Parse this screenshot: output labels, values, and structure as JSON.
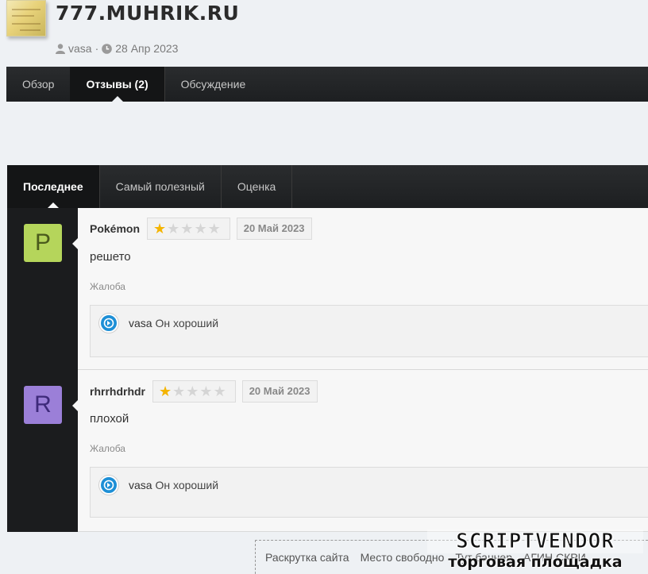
{
  "header": {
    "title": "777.MUHRIK.RU",
    "author": "vasa",
    "separator": "·",
    "date": "28 Апр 2023"
  },
  "resource_tabs": [
    "Обзор",
    "Отзывы (2)",
    "Обсуждение"
  ],
  "review_tabs": [
    "Последнее",
    "Самый полезный",
    "Оценка"
  ],
  "reviews": [
    {
      "avatar_letter": "P",
      "avatar_color": "#b5d55b",
      "author": "Pokémon",
      "rating": 1,
      "rating_max": 5,
      "date": "20 Май 2023",
      "text": "решето",
      "complaint": "Жалоба",
      "reply_author": "vasa",
      "reply_text": "Он хороший"
    },
    {
      "avatar_letter": "R",
      "avatar_color": "#9b7fd8",
      "author": "rhrrhdrhdr",
      "rating": 1,
      "rating_max": 5,
      "date": "20 Май 2023",
      "text": "плохой",
      "complaint": "Жалоба",
      "reply_author": "vasa",
      "reply_text": "Он хороший"
    }
  ],
  "footer": {
    "links": [
      "Раскрутка сайта",
      "Место свободно",
      "Тут баннер",
      "АГИН СКРИ"
    ]
  },
  "watermark": {
    "main": "SCRIPTVENDOR",
    "sub": "торговая площадка"
  }
}
